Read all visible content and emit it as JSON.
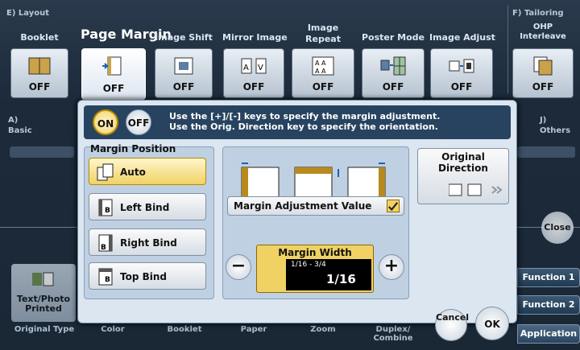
{
  "header": {
    "layout_section": "E)  Layout",
    "tailoring_section": "F)  Tailoring",
    "basic_section": "A)\nBasic",
    "others_section": "J)\nOthers"
  },
  "functions": [
    {
      "label": "Booklet",
      "value": "OFF"
    },
    {
      "label": "Page Margin",
      "value": "OFF"
    },
    {
      "label": "Image Shift",
      "value": "OFF"
    },
    {
      "label": "Mirror Image",
      "value": "OFF"
    },
    {
      "label": "Image Repeat",
      "value": "OFF"
    },
    {
      "label": "Poster Mode",
      "value": "OFF"
    },
    {
      "label": "Image Adjust",
      "value": "OFF"
    },
    {
      "label": "OHP Interleave",
      "value": "OFF"
    }
  ],
  "dialog": {
    "on_label": "ON",
    "off_label": "OFF",
    "instruction_line1": "Use the [+]/[-] keys to specify the margin adjustment.",
    "instruction_line2": "Use the Orig. Direction key to specify the orientation.",
    "margin_position_title": "Margin Position",
    "positions": [
      "Auto",
      "Left Bind",
      "Right Bind",
      "Top Bind"
    ],
    "selected_position": "Auto",
    "adjustment_label": "Margin Adjustment Value",
    "adjustment_checked": true,
    "margin_width_title": "Margin Width",
    "margin_width_range": "1/16 - 3/4",
    "margin_width_value": "1/16",
    "minus_label": "−",
    "plus_label": "+",
    "original_direction": "Original\nDirection",
    "cancel_label": "Cancel",
    "ok_label": "OK"
  },
  "background": {
    "close_label": "Close",
    "text_photo": "Text/Photo\nPrinted"
  },
  "right_tabs": [
    "Function 1",
    "Function 2",
    "Application"
  ],
  "bottom_labels": [
    "Original Type",
    "Color",
    "Booklet",
    "Paper",
    "Zoom",
    "Duplex/\nCombine"
  ],
  "colors": {
    "accent_yellow": "#f0d264",
    "dialog_bg": "#dbe6f1",
    "bar_dark": "#27435f"
  }
}
